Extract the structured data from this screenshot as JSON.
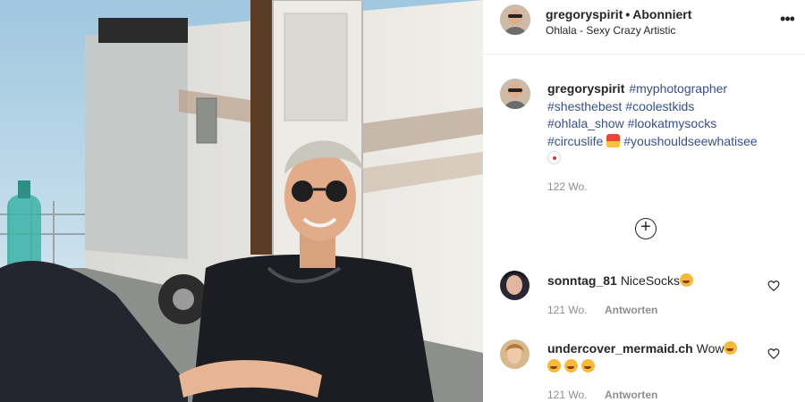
{
  "header": {
    "username": "gregoryspirit",
    "separator": "•",
    "follow_status": "Abonniert",
    "subtitle": "Ohlala - Sexy Crazy Artistic",
    "more_icon": "ellipsis-icon",
    "more_glyph": "•••"
  },
  "caption": {
    "username": "gregoryspirit",
    "lines": [
      [
        "#myphotographer"
      ],
      [
        "#shesthebest",
        "#coolestkids"
      ],
      [
        "#ohlala_show",
        "#lookatmysocks"
      ],
      [
        "#circuslife",
        "#youshouldseewhatisee"
      ]
    ],
    "emoji_icons": [
      "circus-tent-icon",
      "clown-face-icon"
    ],
    "time": "122 Wo."
  },
  "load_more": {
    "icon": "plus-circle-icon",
    "glyph": "+"
  },
  "comments": [
    {
      "username": "sonntag_81",
      "text": "NiceSocks",
      "emoji_icons": [
        "star-struck-icon"
      ],
      "time": "121 Wo.",
      "reply_label": "Antworten",
      "like_icon": "heart-icon"
    },
    {
      "username": "undercover_mermaid.ch",
      "text": "Wow",
      "emoji_icons": [
        "star-struck-icon",
        "star-struck-icon",
        "star-struck-icon",
        "star-struck-icon"
      ],
      "time": "121 Wo.",
      "reply_label": "Antworten",
      "like_icon": "heart-icon"
    }
  ],
  "colors": {
    "hashtag": "#385185",
    "meta": "#8e8e8e",
    "text": "#262626",
    "divider": "#efefef"
  }
}
